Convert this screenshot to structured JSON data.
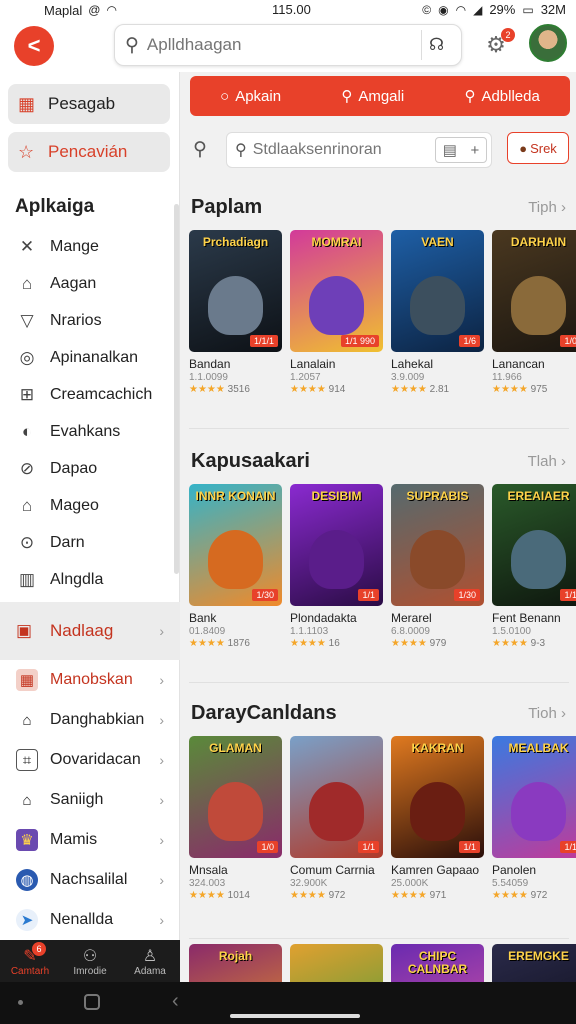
{
  "status": {
    "carrier": "Maplal",
    "time": "115.00",
    "battery": "29%",
    "right_text": "32M"
  },
  "topbar": {
    "search_placeholder": "Aplldhaagan",
    "notif_count": "2"
  },
  "sidebar": {
    "pinned": [
      {
        "label": "Pesagab",
        "icon": "calendar-icon"
      },
      {
        "label": "Pencavián",
        "icon": "star-icon"
      }
    ],
    "section_title": "Aplkaiga",
    "items": [
      {
        "label": "Mange",
        "icon": "crossed-swords-icon"
      },
      {
        "label": "Aagan",
        "icon": "home-icon"
      },
      {
        "label": "Nrarios",
        "icon": "shield-icon"
      },
      {
        "label": "Apinanalkan",
        "icon": "camera-icon"
      },
      {
        "label": "Creamcachich",
        "icon": "grid-icon"
      },
      {
        "label": "Evahkans",
        "icon": "leaf-icon"
      },
      {
        "label": "Dapao",
        "icon": "no-entry-icon"
      },
      {
        "label": "Mageo",
        "icon": "home-icon"
      },
      {
        "label": "Darn",
        "icon": "check-circle-icon"
      },
      {
        "label": "Alngdla",
        "icon": "bars-icon"
      }
    ],
    "subsection": {
      "label": "Nadlaag",
      "icon": "apps-icon"
    },
    "subitems": [
      {
        "label": "Manobskan",
        "icon": "grid-icon",
        "active": true
      },
      {
        "label": "Danghabkian",
        "icon": "home-icon"
      },
      {
        "label": "Oovaridacan",
        "icon": "box-icon"
      },
      {
        "label": "Saniigh",
        "icon": "lock-icon"
      },
      {
        "label": "Mamis",
        "icon": "game-icon"
      },
      {
        "label": "Nachsalilal",
        "icon": "globe-icon"
      },
      {
        "label": "Nenallda",
        "icon": "send-icon"
      }
    ]
  },
  "bottom_nav": [
    {
      "label": "Camtarh",
      "icon": "tag-icon",
      "badge": "6"
    },
    {
      "label": "Imrodie",
      "icon": "people-icon"
    },
    {
      "label": "Adama",
      "icon": "person-icon"
    }
  ],
  "main": {
    "tabs": [
      {
        "label": "Apkain",
        "icon": "circle-icon"
      },
      {
        "label": "Amgali",
        "icon": "search-icon"
      },
      {
        "label": "Adblleda",
        "icon": "search-icon"
      }
    ],
    "search_placeholder": "Stdlaaksenrinoran",
    "action_button": "Srek",
    "sections": [
      {
        "title": "Paplam",
        "more": "Tiph",
        "cards": [
          {
            "art_title": "Prchadiagn",
            "tag": "1/1/1",
            "name": "Bandan",
            "meta": "1.1.0099",
            "rating": "3516",
            "c1": "#2b3a4a",
            "c2": "#0d1116",
            "accent": "#6a7a8c"
          },
          {
            "art_title": "MOMRAI",
            "tag": "1/1 990",
            "name": "Lanalain",
            "meta": "1.2057",
            "rating": "914",
            "c1": "#d23a9a",
            "c2": "#f0c030",
            "accent": "#6e3fb8"
          },
          {
            "art_title": "VAEN",
            "tag": "1/6",
            "name": "Lahekal",
            "meta": "3.9.009",
            "rating": "2.81",
            "c1": "#1e5fa6",
            "c2": "#0c2342",
            "accent": "#3c4f5e"
          },
          {
            "art_title": "DARHAIN",
            "tag": "1/0",
            "name": "Lanancan",
            "meta": "11.966",
            "rating": "975",
            "c1": "#4a3820",
            "c2": "#1b1610",
            "accent": "#8a6a3a"
          }
        ]
      },
      {
        "title": "Kapusaakari",
        "more": "Tlah",
        "cards": [
          {
            "art_title": "INNR KONAIN",
            "tag": "1/30",
            "name": "Bank",
            "meta": "01.8409",
            "rating": "1876",
            "c1": "#35b3c8",
            "c2": "#f08a2a",
            "accent": "#d66a20"
          },
          {
            "art_title": "DESIBIM",
            "tag": "1/1",
            "name": "Plondadakta",
            "meta": "1.1.1103",
            "rating": "16",
            "c1": "#8a2ad0",
            "c2": "#2a0c45",
            "accent": "#5a1d8a"
          },
          {
            "art_title": "SUPRABIS",
            "tag": "1/30",
            "name": "Merarel",
            "meta": "6.8.0009",
            "rating": "979",
            "c1": "#556a6e",
            "c2": "#b05030",
            "accent": "#8a4a2a"
          },
          {
            "art_title": "EREAIAER",
            "tag": "1/1",
            "name": "Fent Benann",
            "meta": "1.5.0100",
            "rating": "9-3",
            "c1": "#2a5a2a",
            "c2": "#0e160e",
            "accent": "#4a6a7a"
          }
        ]
      },
      {
        "title": "DarayCanldans",
        "more": "Tioh",
        "cards": [
          {
            "art_title": "GLAMAN",
            "tag": "1/0",
            "name": "Mnsala",
            "meta": "324.003",
            "rating": "1014",
            "c1": "#5a8a3a",
            "c2": "#8a2a6a",
            "accent": "#c04a3a"
          },
          {
            "art_title": "",
            "tag": "1/1",
            "name": "Comum Carrnia",
            "meta": "32.900K",
            "rating": "972",
            "c1": "#7aa0c8",
            "c2": "#b03a2a",
            "accent": "#a02a2a"
          },
          {
            "art_title": "KAKRAN",
            "tag": "1/1",
            "name": "Kamren Gapaao",
            "meta": "25.000K",
            "rating": "971",
            "c1": "#e07a20",
            "c2": "#2a0e0a",
            "accent": "#6a1e12"
          },
          {
            "art_title": "MEALBAK",
            "tag": "1/1",
            "name": "Panolen",
            "meta": "5.54059",
            "rating": "972",
            "c1": "#3a7ae0",
            "c2": "#c03a9a",
            "accent": "#8a3ac0"
          }
        ]
      },
      {
        "title": "",
        "more": "",
        "cards": [
          {
            "art_title": "Rojah",
            "tag": "",
            "name": "",
            "meta": "",
            "rating": "",
            "c1": "#8a2a6a",
            "c2": "#f0a020",
            "accent": "#c03a2a"
          },
          {
            "art_title": "",
            "tag": "",
            "name": "",
            "meta": "",
            "rating": "",
            "c1": "#e0a030",
            "c2": "#3a9a3a",
            "accent": "#c04030"
          },
          {
            "art_title": "CHIPC CALNBAR",
            "tag": "",
            "name": "",
            "meta": "",
            "rating": "",
            "c1": "#6a2ab0",
            "c2": "#e05aa0",
            "accent": "#3a2a6a"
          },
          {
            "art_title": "EREMGKE",
            "tag": "",
            "name": "",
            "meta": "",
            "rating": "",
            "c1": "#2a2a4a",
            "c2": "#0a0a14",
            "accent": "#5a5a8a"
          }
        ]
      }
    ]
  }
}
